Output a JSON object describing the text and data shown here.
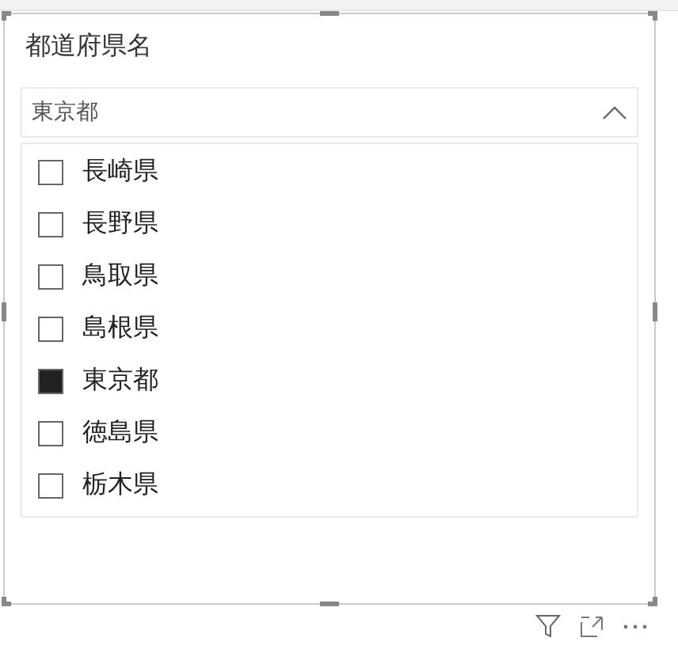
{
  "slicer": {
    "title": "都道府県名",
    "dropdown": {
      "value": "東京都",
      "expanded": true
    },
    "items": [
      {
        "label": "長崎県",
        "checked": false
      },
      {
        "label": "長野県",
        "checked": false
      },
      {
        "label": "鳥取県",
        "checked": false
      },
      {
        "label": "島根県",
        "checked": false
      },
      {
        "label": "東京都",
        "checked": true
      },
      {
        "label": "徳島県",
        "checked": false
      },
      {
        "label": "栃木県",
        "checked": false
      }
    ]
  }
}
